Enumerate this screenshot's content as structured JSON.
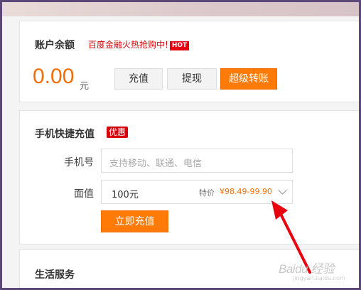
{
  "balance": {
    "title": "账户余额",
    "promo": "百度金融火热抢购中!",
    "hot_badge": "HOT",
    "amount": "0.00",
    "unit": "元",
    "buttons": {
      "recharge": "充值",
      "withdraw": "提现",
      "transfer": "超级转账"
    }
  },
  "mobile_recharge": {
    "title": "手机快捷充值",
    "badge": "优惠",
    "phone": {
      "label": "手机号",
      "placeholder": "支持移动、联通、电信"
    },
    "face_value": {
      "label": "面值",
      "selected": "100元",
      "price_label": "特价",
      "price": "¥98.49-99.90"
    },
    "submit": "立即充值"
  },
  "life_services": {
    "title": "生活服务"
  },
  "watermark": {
    "text": "Baidu 经验",
    "sub": "jingyan.baidu.com"
  },
  "colors": {
    "accent": "#ff7a06",
    "price": "#f26e0a",
    "promo_red": "#d40000",
    "arrow": "#e8000f"
  }
}
